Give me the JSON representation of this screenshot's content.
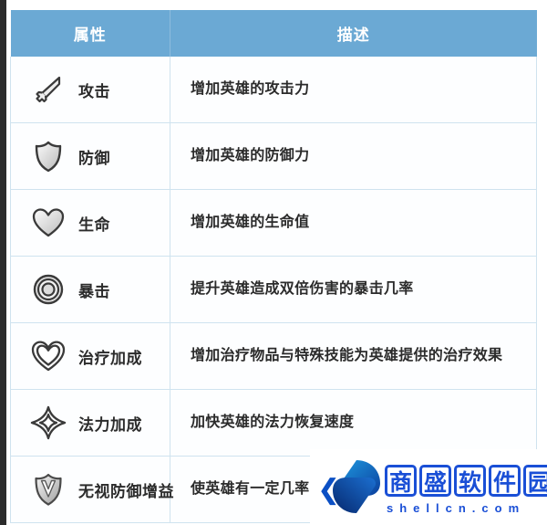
{
  "table": {
    "headers": {
      "attribute": "属性",
      "description": "描述"
    },
    "rows": [
      {
        "icon": "sword-icon",
        "name": "攻击",
        "description": "增加英雄的攻击力"
      },
      {
        "icon": "shield-icon",
        "name": "防御",
        "description": "增加英雄的防御力"
      },
      {
        "icon": "heart-icon",
        "name": "生命",
        "description": "增加英雄的生命值"
      },
      {
        "icon": "target-rings-icon",
        "name": "暴击",
        "description": "提升英雄造成双倍伤害的暴击几率"
      },
      {
        "icon": "heart-outline-icon",
        "name": "治疗加成",
        "description": "增加治疗物品与特殊技能为英雄提供的治疗效果"
      },
      {
        "icon": "diamond-star-icon",
        "name": "法力加成",
        "description": "加快英雄的法力恢复速度"
      },
      {
        "icon": "shield-v-icon",
        "name": "无视防御增益",
        "description": "使英雄有一定几率"
      }
    ]
  },
  "watermark": {
    "chevron": "❮",
    "chars": [
      "商",
      "盛",
      "软",
      "件",
      "园"
    ],
    "domain": "shellcn.com"
  },
  "colors": {
    "header_blue": "#6ba9d4",
    "grid_line": "#cfe3ef",
    "text": "#2b2b2b",
    "watermark_blue": "#1a4fd6"
  }
}
